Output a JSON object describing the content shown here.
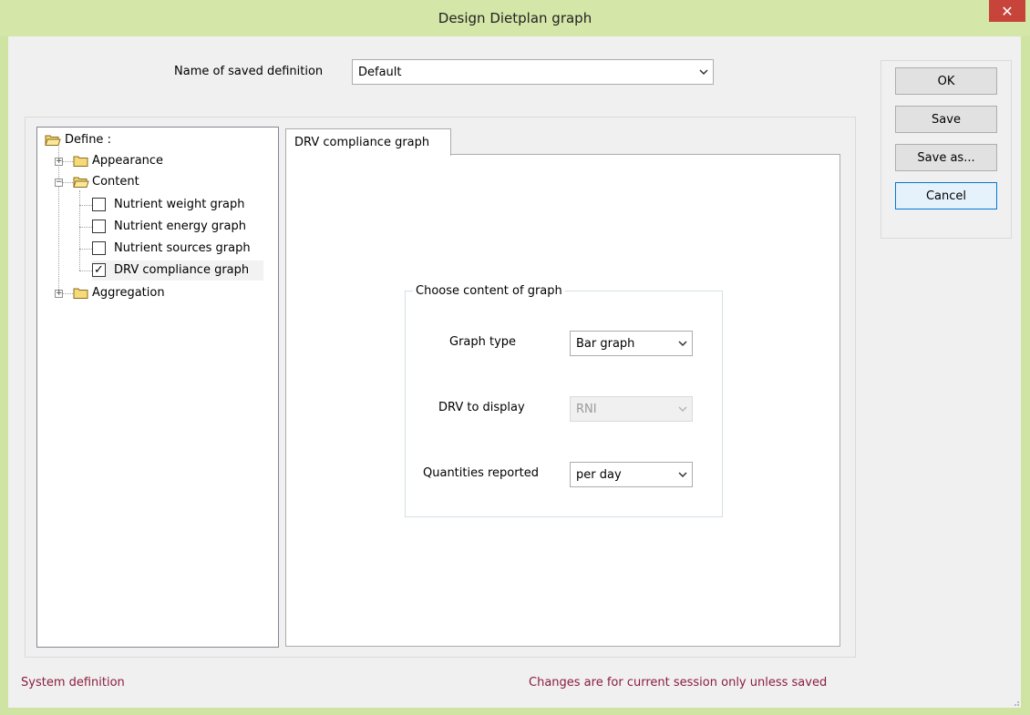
{
  "window": {
    "title": "Design Dietplan graph",
    "close_glyph": "✕"
  },
  "definition": {
    "label": "Name of saved definition",
    "value": "Default"
  },
  "buttons": {
    "ok": "OK",
    "save": "Save",
    "save_as": "Save as...",
    "cancel": "Cancel"
  },
  "tree": {
    "root": "Define :",
    "appearance": "Appearance",
    "content": "Content",
    "content_items": [
      {
        "label": "Nutrient weight graph",
        "checked": false
      },
      {
        "label": "Nutrient energy graph",
        "checked": false
      },
      {
        "label": "Nutrient sources graph",
        "checked": false
      },
      {
        "label": "DRV compliance graph",
        "checked": true
      }
    ],
    "aggregation": "Aggregation",
    "check_glyph": "✓",
    "expand_glyph": "+",
    "collapse_glyph": "−"
  },
  "tab": {
    "label": "DRV compliance graph"
  },
  "group": {
    "title": "Choose content of graph",
    "graph_type_label": "Graph type",
    "graph_type_value": "Bar graph",
    "drv_label": "DRV to display",
    "drv_value": "RNI",
    "quantities_label": "Quantities reported",
    "quantities_value": "per day"
  },
  "status": {
    "left": "System definition",
    "right": "Changes are for current session only unless saved"
  },
  "icons": {
    "chevron": "chevron-down-icon",
    "folder": "folder-icon",
    "open_folder": "open-folder-icon",
    "resize": "resize-grip-icon"
  },
  "colors": {
    "titlebar": "#d4e6a8",
    "close": "#c7443b",
    "status_text": "#8b1c3e",
    "focus": "#0078d7"
  }
}
